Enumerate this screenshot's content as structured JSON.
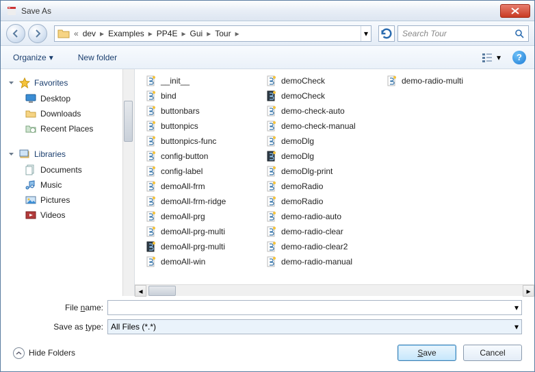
{
  "title": "Save As",
  "breadcrumbs": [
    "dev",
    "Examples",
    "PP4E",
    "Gui",
    "Tour"
  ],
  "search": {
    "placeholder": "Search Tour"
  },
  "toolbar": {
    "organize": "Organize",
    "newfolder": "New folder"
  },
  "sidebar": {
    "favorites": {
      "label": "Favorites",
      "items": [
        "Desktop",
        "Downloads",
        "Recent Places"
      ]
    },
    "libraries": {
      "label": "Libraries",
      "items": [
        "Documents",
        "Music",
        "Pictures",
        "Videos"
      ]
    }
  },
  "files": [
    "__init__",
    "bind",
    "buttonbars",
    "buttonpics",
    "buttonpics-func",
    "config-button",
    "config-label",
    "demoAll-frm",
    "demoAll-frm-ridge",
    "demoAll-prg",
    "demoAll-prg-multi",
    "demoAll-prg-multi",
    "demoAll-win",
    "demoCheck",
    "demoCheck",
    "demo-check-auto",
    "demo-check-manual",
    "demoDlg",
    "demoDlg",
    "demoDlg-print",
    "demoRadio",
    "demoRadio",
    "demo-radio-auto",
    "demo-radio-clear",
    "demo-radio-clear2",
    "demo-radio-manual",
    "demo-radio-multi"
  ],
  "dark_file_indices": [
    11,
    14,
    18
  ],
  "form": {
    "filename_label": "File name:",
    "filename_value": "",
    "type_label": "Save as type:",
    "type_value": "All Files (*.*)"
  },
  "footer": {
    "hide": "Hide Folders",
    "save": "Save",
    "cancel": "Cancel"
  }
}
